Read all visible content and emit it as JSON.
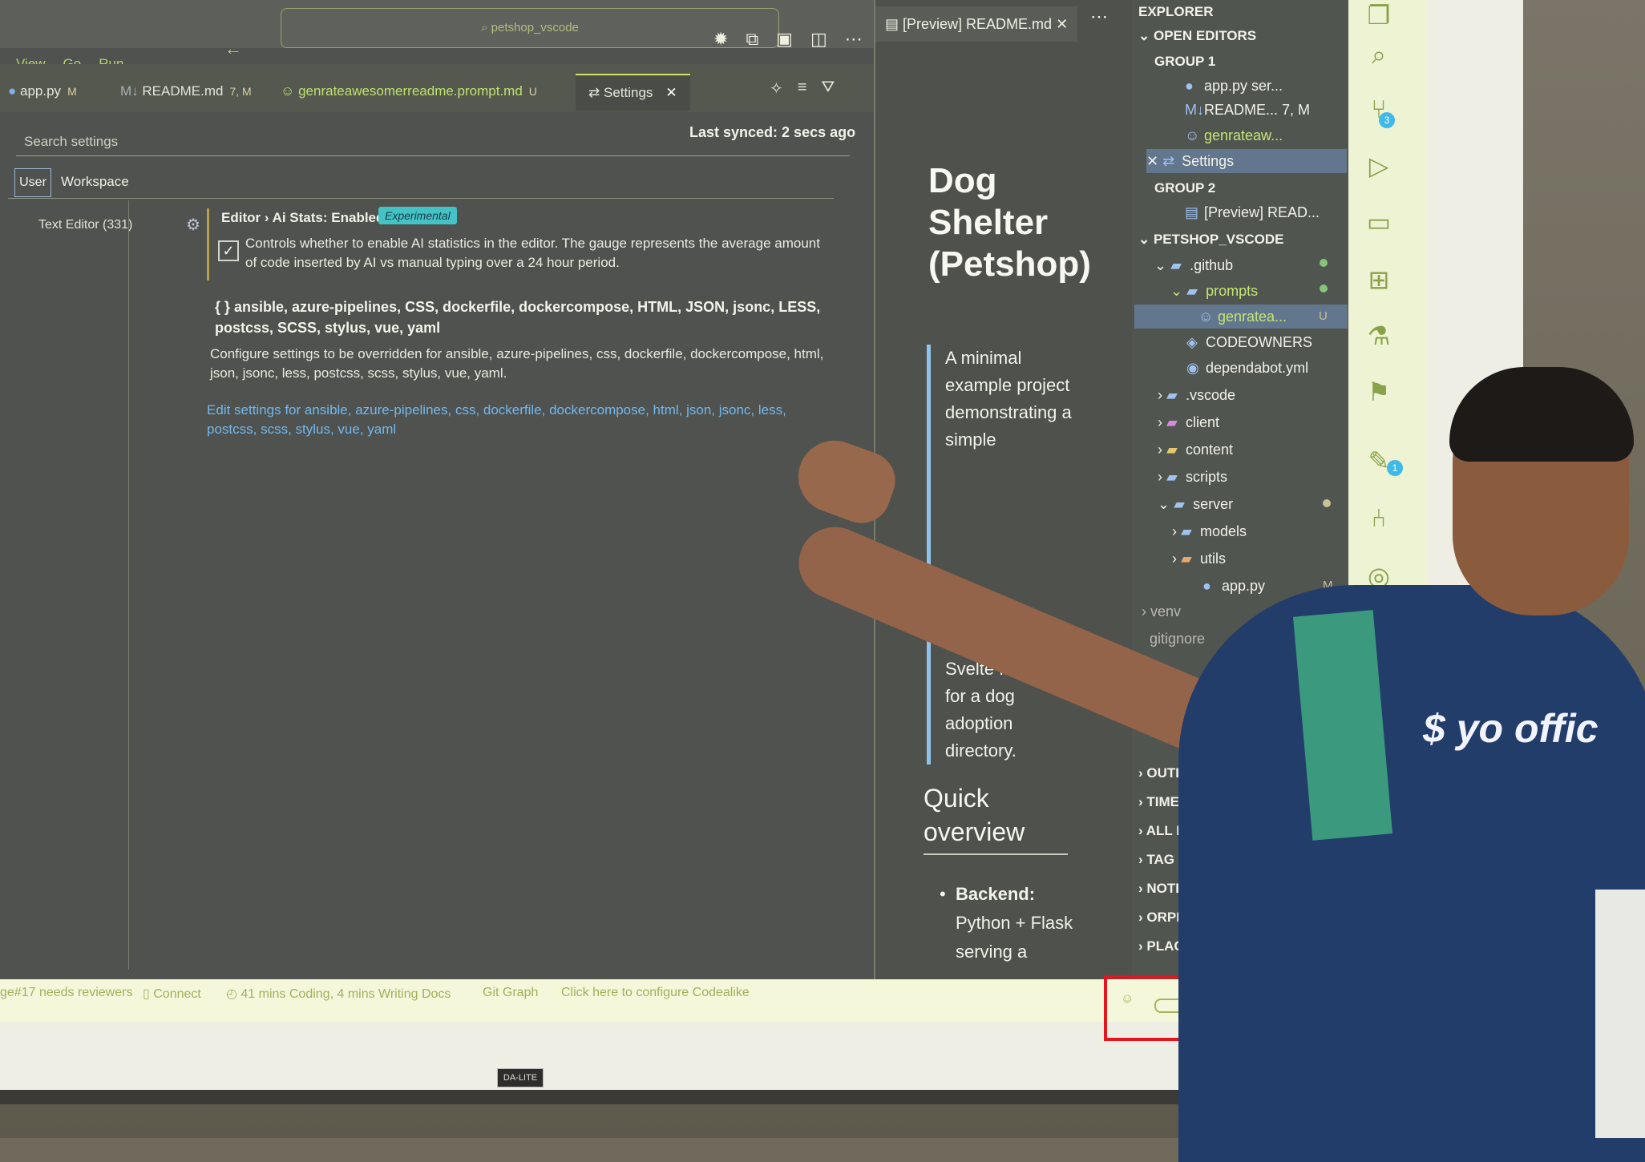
{
  "topbar": {
    "menu": [
      "View",
      "Go",
      "Run",
      "..."
    ],
    "command_center": "petshop_vscode"
  },
  "editor_tabs": [
    {
      "label": "app.py",
      "status": "M"
    },
    {
      "label": "README.md",
      "status": "7, M"
    },
    {
      "label": "genrateawesomerreadme.prompt.md",
      "status": "U"
    },
    {
      "label": "Settings"
    }
  ],
  "settings": {
    "search_placeholder": "Search settings",
    "last_synced": "Last synced: 2 secs ago",
    "scope_user": "User",
    "scope_workspace": "Workspace",
    "toc_item": "Text Editor (331)",
    "ai_stats_title": "Editor › Ai Stats: Enabled",
    "ai_stats_badge": "Experimental",
    "ai_stats_checked": true,
    "ai_stats_desc": "Controls whether to enable AI statistics in the editor. The gauge represents the average amount of code inserted by AI vs manual typing over a 24 hour period.",
    "lang_title": "{ } ansible, azure-pipelines, CSS, dockerfile, dockercompose, HTML, JSON, jsonc, LESS, postcss, SCSS, stylus, vue, yaml",
    "lang_desc": "Configure settings to be overridden for ansible, azure-pipelines, css, dockerfile, dockercompose, html, json, jsonc, less, postcss, scss, stylus, vue, yaml.",
    "lang_link": "Edit settings for ansible, azure-pipelines, css, dockerfile, dockercompose, html, json, jsonc, less, postcss, scss, stylus, vue, yaml"
  },
  "preview": {
    "tab": "[Preview] README.md",
    "h1": "Dog Shelter (Petshop)",
    "quote_top": "A minimal example project demonstrating a simple",
    "quote_bottom": "Svelte frontend for a dog adoption directory.",
    "h2": "Quick overview",
    "bullet_label": "Backend:",
    "bullet_text": "Python + Flask serving a"
  },
  "explorer": {
    "title": "EXPLORER",
    "open_editors": "OPEN EDITORS",
    "group1": "GROUP 1",
    "group1_items": [
      {
        "label": "app.py ser...",
        "status": "M"
      },
      {
        "label": "README... 7, M",
        "status": ""
      },
      {
        "label": "genrateaw...",
        "status": "U"
      },
      {
        "label": "Settings",
        "status": ""
      }
    ],
    "group2": "GROUP 2",
    "group2_items": [
      {
        "label": "[Preview] READ..."
      }
    ],
    "project": "PETSHOP_VSCODE",
    "tree": [
      {
        "label": ".github"
      },
      {
        "label": "prompts"
      },
      {
        "label": "genratea...",
        "status": "U"
      },
      {
        "label": "CODEOWNERS"
      },
      {
        "label": "dependabot.yml"
      },
      {
        "label": ".vscode"
      },
      {
        "label": "client"
      },
      {
        "label": "content"
      },
      {
        "label": "scripts"
      },
      {
        "label": "server"
      },
      {
        "label": "models"
      },
      {
        "label": "utils"
      },
      {
        "label": "app.py",
        "status": "M"
      }
    ],
    "tree_partial": [
      "venv",
      "gitignore"
    ],
    "sections": [
      "OUTLINE",
      "TIMELINE",
      "ALL LINKS (0)",
      "TAG EXPLORER (1)",
      "NOTES",
      "ORPHANS (22)",
      "PLACEHOLDERS (5)"
    ]
  },
  "statusbar": {
    "pr": "ge#17 needs reviewers",
    "connect": "Connect",
    "coding": "41 mins Coding, 4 mins Writing Docs",
    "gitgraph": "Git Graph",
    "codealike": "Click here to configure Codealike"
  },
  "shirt": {
    "text": "$ yo offic"
  },
  "projector": {
    "brand": "DA-LITE"
  },
  "colors": {
    "accent": "#d5e36a",
    "badge": "#44c3c6",
    "link": "#73b8ee",
    "highlight_box": "#e4151c"
  }
}
